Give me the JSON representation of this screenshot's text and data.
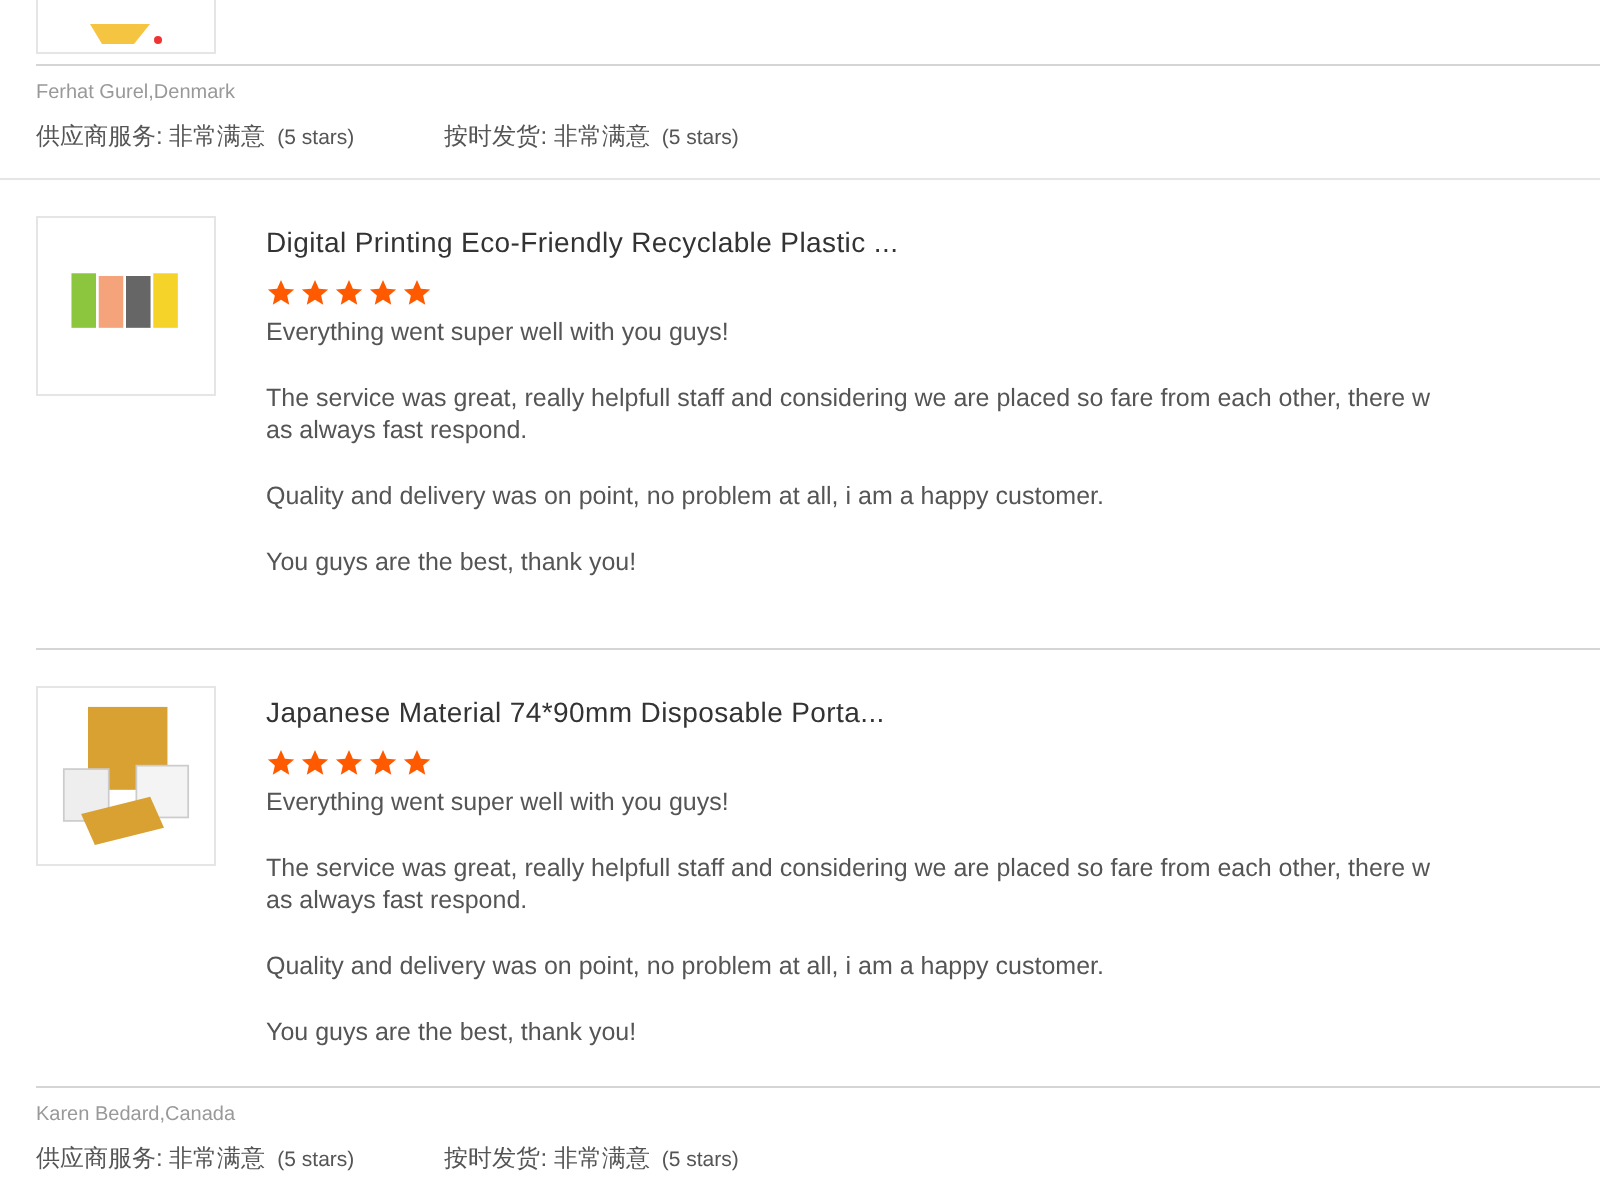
{
  "reviews": [
    {
      "reviewer": "Ferhat Gurel,Denmark",
      "ratings": [
        {
          "label": "供应商服务: 非常满意",
          "score": "(5 stars)"
        },
        {
          "label": "按时发货: 非常满意",
          "score": "(5 stars)"
        }
      ]
    },
    {
      "products": [
        {
          "title": "Digital Printing Eco-Friendly Recyclable Plastic ...",
          "stars": 5,
          "paragraphs": [
            "Everything went super well with you guys!",
            "The service was great, really helpfull staff and considering we are placed so fare from each other, there was always fast respond.",
            "Quality and delivery was on point, no problem at all, i am a happy customer.",
            "You guys are the best, thank you!"
          ]
        },
        {
          "title": "Japanese Material 74*90mm Disposable Porta...",
          "stars": 5,
          "paragraphs": [
            "Everything went super well with you guys!",
            "The service was great, really helpfull staff and considering we are placed so fare from each other, there was always fast respond.",
            "Quality and delivery was on point, no problem at all, i am a happy customer.",
            "You guys are the best, thank you!"
          ]
        }
      ],
      "reviewer": "Karen Bedard,Canada",
      "ratings": [
        {
          "label": "供应商服务: 非常满意",
          "score": "(5 stars)"
        },
        {
          "label": "按时发货: 非常满意",
          "score": "(5 stars)"
        }
      ]
    }
  ]
}
